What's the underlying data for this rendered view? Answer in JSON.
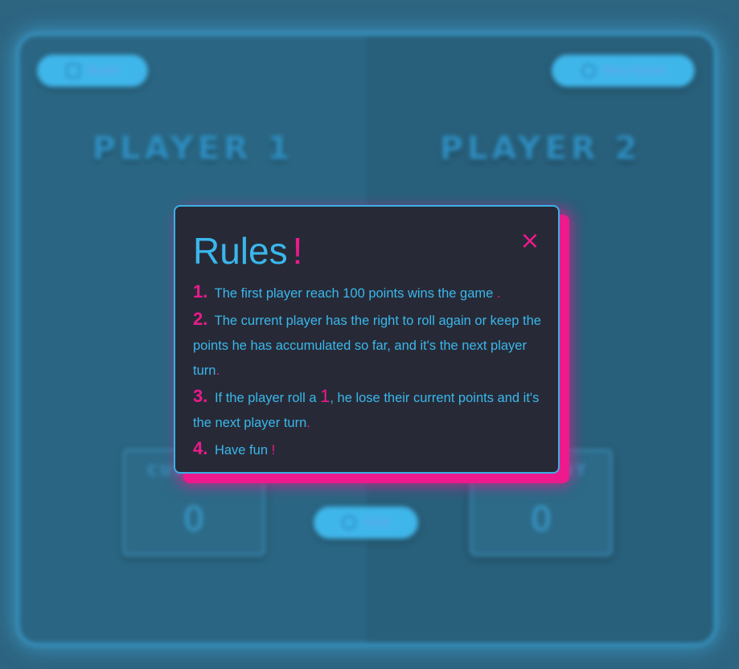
{
  "board": {
    "rules_button": "Rules",
    "new_game_button": "New Game",
    "hold_button": "Hold",
    "players": [
      {
        "name": "PLAYER 1",
        "current_label": "CURRENT",
        "current_score": "0"
      },
      {
        "name": "PLAYER 2",
        "current_label": "CURRENT",
        "current_score": "0"
      }
    ]
  },
  "modal": {
    "title": "Rules",
    "title_mark": "!",
    "close": "×",
    "rules": [
      {
        "num": "1.",
        "text": "The first player reach 100 points wins the game",
        "end": "."
      },
      {
        "num": "2.",
        "text": "The current player has the right to roll again or keep the points he has accumulated so far, and it's the next player turn",
        "end": "."
      },
      {
        "num": "3.",
        "text_a": "If the player roll a",
        "big": "1",
        "text_b": ", he lose their current points and it's the next player turn",
        "end": "."
      },
      {
        "num": "4.",
        "text": "Have fun",
        "end": "!"
      }
    ]
  },
  "colors": {
    "accent_blue": "#3ab7ec",
    "accent_pink": "#ec1a8c",
    "modal_bg": "#272a36"
  }
}
